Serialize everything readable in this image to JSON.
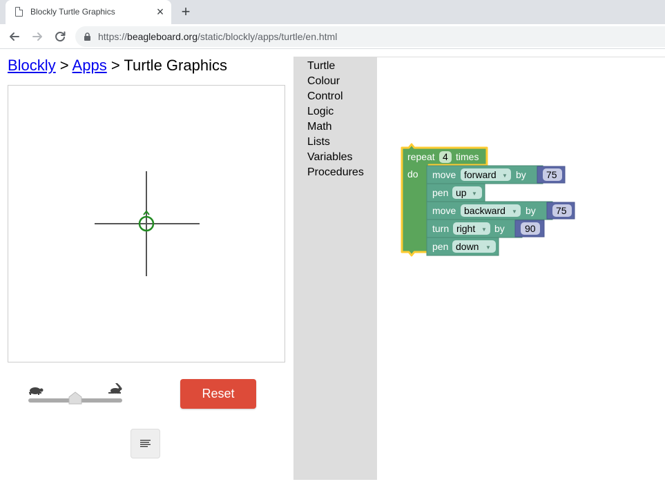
{
  "browser": {
    "tab_title": "Blockly Turtle Graphics",
    "tab_close": "×",
    "new_tab": "+",
    "url_prefix": "https://",
    "url_host": "beagleboard.org",
    "url_path": "/static/blockly/apps/turtle/en.html"
  },
  "breadcrumb": {
    "link1": "Blockly",
    "sep1": " > ",
    "link2": "Apps",
    "sep2": " > ",
    "current": "Turtle Graphics"
  },
  "speed": {
    "value": 0.5
  },
  "reset_label": "Reset",
  "toolbox": {
    "items": [
      "Turtle",
      "Colour",
      "Control",
      "Logic",
      "Math",
      "Lists",
      "Variables",
      "Procedures"
    ]
  },
  "blocks": {
    "repeat": {
      "keyword": "repeat",
      "count": "4",
      "times": "times",
      "do": "do"
    },
    "move1": {
      "label": "move",
      "direction": "forward",
      "by": "by",
      "value": "75"
    },
    "pen1": {
      "label": "pen",
      "state": "up"
    },
    "move2": {
      "label": "move",
      "direction": "backward",
      "by": "by",
      "value": "75"
    },
    "turn": {
      "label": "turn",
      "direction": "right",
      "by": "by",
      "value": "90"
    },
    "pen2": {
      "label": "pen",
      "state": "down"
    }
  },
  "colors": {
    "control_block": "#5ba55b",
    "turtle_block": "#5ba58c",
    "math_block": "#5b67a5",
    "selected_outline": "#fc3",
    "reset_button": "#dd4b39",
    "toolbox_bg": "#dddddd",
    "turtle_color": "#228b22"
  }
}
